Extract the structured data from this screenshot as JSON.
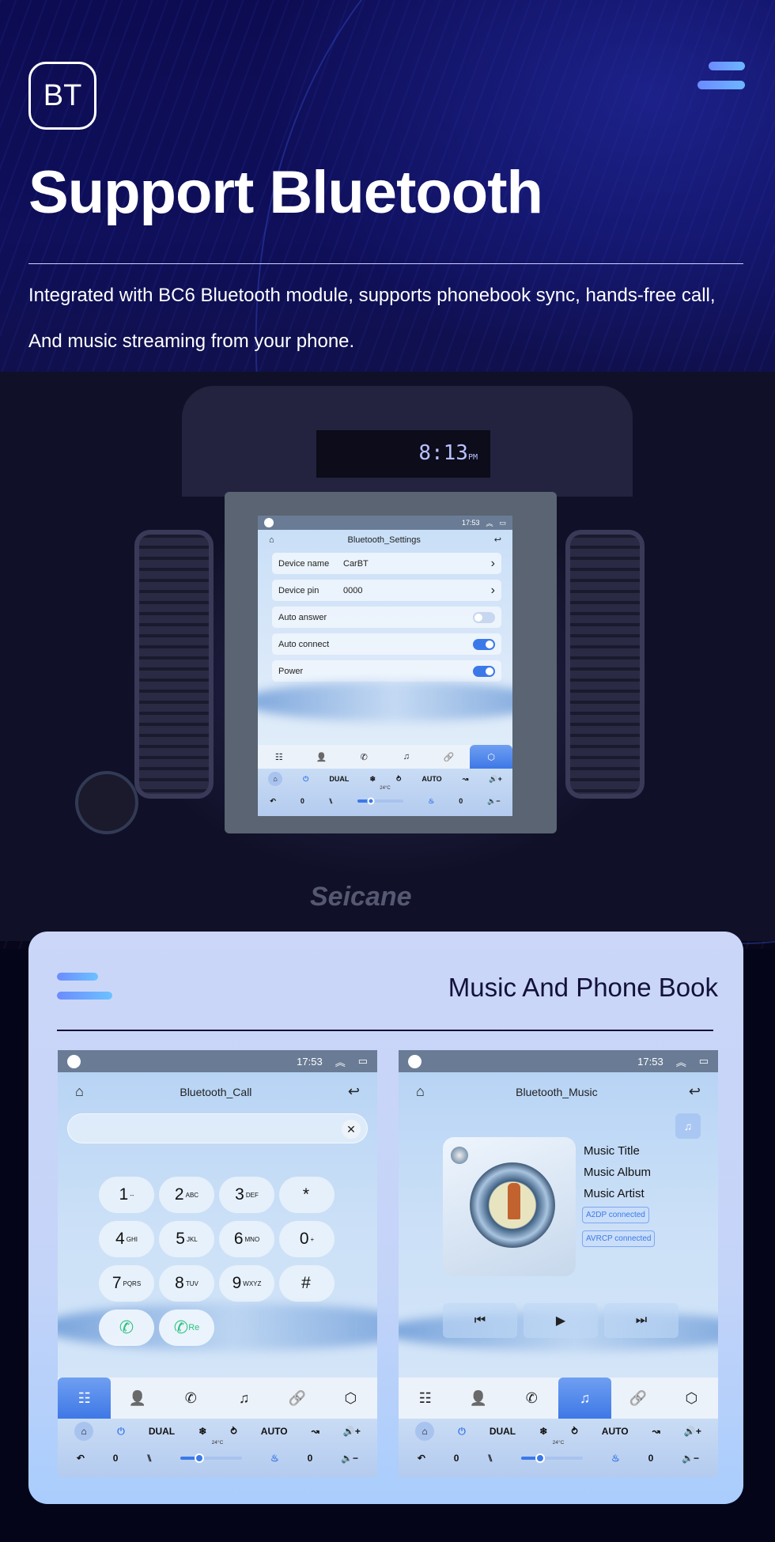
{
  "hero": {
    "badge": "BT",
    "title": "Support Bluetooth",
    "desc_line1": "Integrated with BC6 Bluetooth module, supports phonebook sync, hands-free call,",
    "desc_line2": "And music streaming from your phone."
  },
  "dashboard": {
    "clock": "8:13",
    "clock_suffix": "PM",
    "brand": "Seicane"
  },
  "settings_screen": {
    "time": "17:53",
    "title": "Bluetooth_Settings",
    "rows": [
      {
        "label": "Device name",
        "value": "CarBT",
        "type": "link"
      },
      {
        "label": "Device pin",
        "value": "0000",
        "type": "link"
      },
      {
        "label": "Auto answer",
        "type": "toggle",
        "on": false
      },
      {
        "label": "Auto connect",
        "type": "toggle",
        "on": true
      },
      {
        "label": "Power",
        "type": "toggle",
        "on": true
      }
    ]
  },
  "dock": {
    "items": [
      "dialpad",
      "contacts",
      "call-log",
      "music",
      "link",
      "settings"
    ]
  },
  "climate": {
    "dual": "DUAL",
    "auto": "AUTO",
    "temp": "24°C",
    "left_value": "0",
    "right_value": "0",
    "fan_level_fraction": 0.3
  },
  "card": {
    "title": "Music And Phone Book"
  },
  "call_screen": {
    "time": "17:53",
    "title": "Bluetooth_Call",
    "input_value": "",
    "keys": [
      {
        "d": "1",
        "s": "--"
      },
      {
        "d": "2",
        "s": "ABC"
      },
      {
        "d": "3",
        "s": "DEF"
      },
      {
        "d": "*",
        "s": ""
      },
      {
        "d": "4",
        "s": "GHI"
      },
      {
        "d": "5",
        "s": "JKL"
      },
      {
        "d": "6",
        "s": "MNO"
      },
      {
        "d": "0",
        "s": "+"
      },
      {
        "d": "7",
        "s": "PQRS"
      },
      {
        "d": "8",
        "s": "TUV"
      },
      {
        "d": "9",
        "s": "WXYZ"
      },
      {
        "d": "#",
        "s": ""
      }
    ],
    "redial_label": "Re",
    "active_dock": 0
  },
  "music_screen": {
    "time": "17:53",
    "title": "Bluetooth_Music",
    "music_title": "Music Title",
    "music_album": "Music Album",
    "music_artist": "Music Artist",
    "a2dp": "A2DP  connected",
    "avrcp": "AVRCP connected",
    "active_dock": 3
  }
}
